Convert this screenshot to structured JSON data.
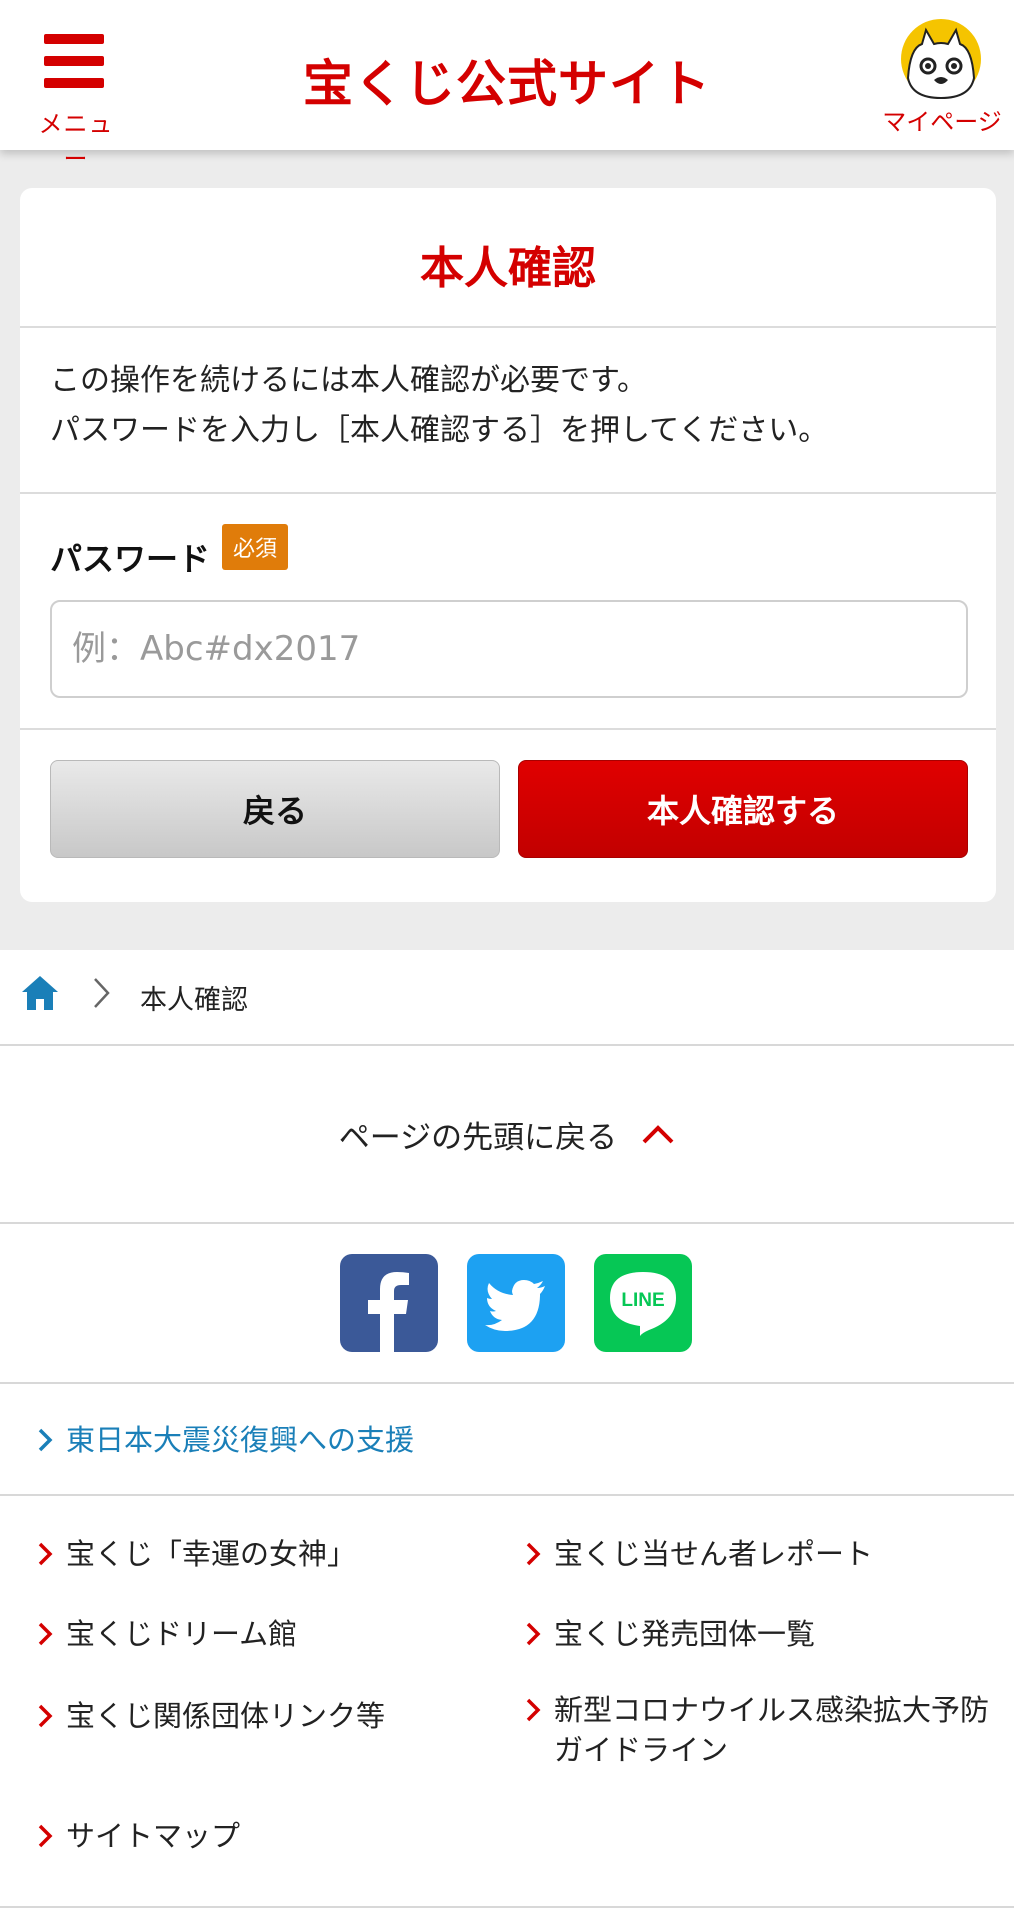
{
  "header": {
    "menu_label": "メニュー",
    "site_title": "宝くじ公式サイト",
    "mypage_label": "マイページ"
  },
  "verify": {
    "title": "本人確認",
    "message_line1": "この操作を続けるには本人確認が必要です。",
    "message_line2": "パスワードを入力し［本人確認する］を押してください。",
    "password_label": "パスワード",
    "required_badge": "必須",
    "password_placeholder": "例：Abc#dx2017",
    "password_value": "",
    "back_button": "戻る",
    "confirm_button": "本人確認する"
  },
  "breadcrumb": {
    "current": "本人確認"
  },
  "back_to_top": "ページの先頭に戻る",
  "social": {
    "line_text": "LINE"
  },
  "links": {
    "support": "東日本大震災復興への支援",
    "goddess": "宝くじ「幸運の女神」",
    "winner_report": "宝くじ当せん者レポート",
    "dream_hall": "宝くじドリーム館",
    "sellers": "宝くじ発売団体一覧",
    "related_links": "宝くじ関係団体リンク等",
    "covid_line1": "新型コロナウイルス感染拡大予防",
    "covid_line2": "ガイドライン",
    "sitemap": "サイトマップ"
  },
  "colors": {
    "brand_red": "#d40000",
    "link_blue": "#1a7fb8",
    "badge_orange": "#e07c0a"
  }
}
